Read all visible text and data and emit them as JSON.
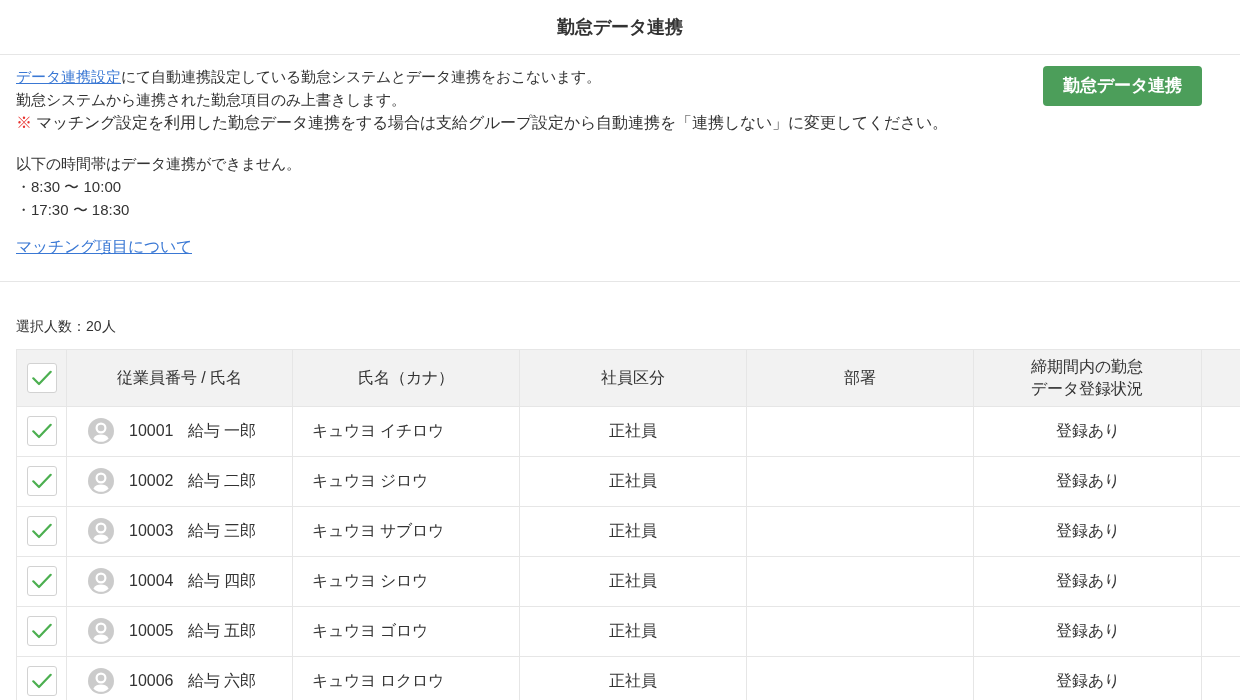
{
  "page_title": "勤怠データ連携",
  "intro": {
    "lead_link": "データ連携設定",
    "lead_rest": "にて自動連携設定している勤怠システムとデータ連携をおこないます。",
    "overwrite_note": "勤怠システムから連携された勤怠項目のみ上書きします。",
    "warning_mark": "※",
    "warning_text": "マッチング設定を利用した勤怠データ連携をする場合は支給グループ設定から自動連携を「連携しない」に変更してください。",
    "restriction_lines": [
      "以下の時間帯はデータ連携ができません。",
      "・8:30 〜 10:00",
      "・17:30 〜 18:30"
    ],
    "matching_link": "マッチング項目について"
  },
  "sync_button": "勤怠データ連携",
  "selected_count": "選択人数：20人",
  "table": {
    "select_all": {
      "checked": true
    },
    "columns": [
      "従業員番号 / 氏名",
      "氏名（カナ）",
      "社員区分",
      "部署",
      "締期間内の勤怠データ登録状況"
    ],
    "rows": [
      {
        "checked": true,
        "employee_no": "10001",
        "name": "給与 一郎",
        "kana": "キュウヨ イチロウ",
        "employment_type": "正社員",
        "status": "登録あり"
      },
      {
        "checked": true,
        "employee_no": "10002",
        "name": "給与 二郎",
        "kana": "キュウヨ ジロウ",
        "employment_type": "正社員",
        "status": "登録あり"
      },
      {
        "checked": true,
        "employee_no": "10003",
        "name": "給与 三郎",
        "kana": "キュウヨ サブロウ",
        "employment_type": "正社員",
        "status": "登録あり"
      },
      {
        "checked": true,
        "employee_no": "10004",
        "name": "給与 四郎",
        "kana": "キュウヨ シロウ",
        "employment_type": "正社員",
        "status": "登録あり"
      },
      {
        "checked": true,
        "employee_no": "10005",
        "name": "給与 五郎",
        "kana": "キュウヨ ゴロウ",
        "employment_type": "正社員",
        "status": "登録あり"
      },
      {
        "checked": true,
        "employee_no": "10006",
        "name": "給与 六郎",
        "kana": "キュウヨ ロクロウ",
        "employment_type": "正社員",
        "status": "登録あり"
      }
    ]
  }
}
